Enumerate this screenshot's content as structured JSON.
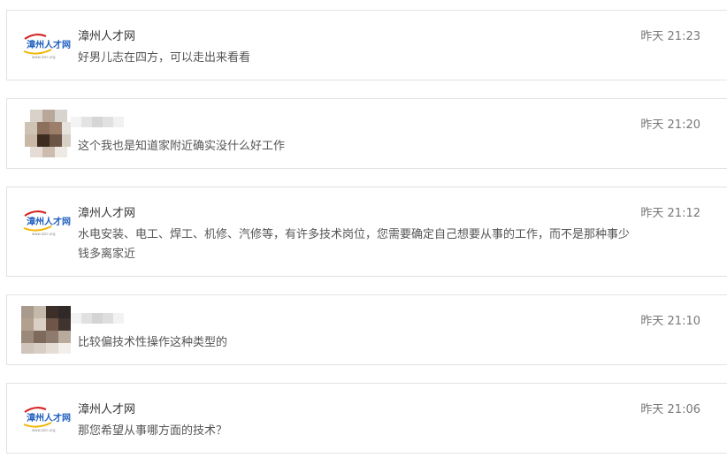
{
  "brand_name": "漳州人才网",
  "logo": {
    "text": "漳州人才网",
    "url": "www.zzrc.org"
  },
  "messages": [
    {
      "sender": "漳州人才网",
      "avatar": "zzrc-logo",
      "time": "昨天 21:23",
      "text": "好男儿志在四方，可以走出来看看"
    },
    {
      "sender": "",
      "avatar": "blurred-user-photo",
      "time": "昨天 21:20",
      "text": "这个我也是知道家附近确实没什么好工作"
    },
    {
      "sender": "漳州人才网",
      "avatar": "zzrc-logo",
      "time": "昨天 21:12",
      "text": "水电安装、电工、焊工、机修、汽修等，有许多技术岗位，您需要确定自己想要从事的工作，而不是那种事少钱多离家近"
    },
    {
      "sender": "",
      "avatar": "blurred-user-photo",
      "time": "昨天 21:10",
      "text": "比较偏技术性操作这种类型的"
    },
    {
      "sender": "漳州人才网",
      "avatar": "zzrc-logo",
      "time": "昨天 21:06",
      "text": "那您希望从事哪方面的技术？"
    }
  ]
}
